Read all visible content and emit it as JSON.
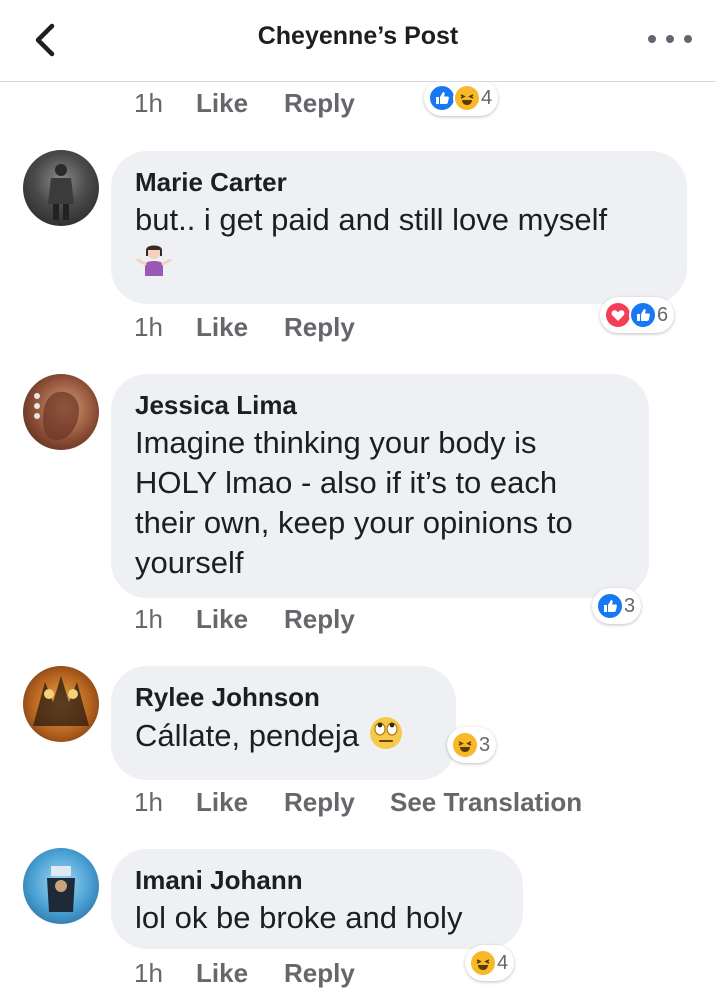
{
  "header": {
    "title": "Cheyenne’s Post"
  },
  "top_row": {
    "time": "1h",
    "like": "Like",
    "reply": "Reply",
    "reaction_count": "4"
  },
  "comments": [
    {
      "author": "Marie Carter",
      "text": "but.. i get paid and still love myself",
      "emoji": "woman-shrugging-emoji",
      "time": "1h",
      "like": "Like",
      "reply": "Reply",
      "reaction_count": "6"
    },
    {
      "author": "Jessica Lima",
      "text": "Imagine thinking your body is HOLY lmao - also if it’s to each their own, keep your opinions to yourself",
      "time": "1h",
      "like": "Like",
      "reply": "Reply",
      "reaction_count": "3"
    },
    {
      "author": "Rylee Johnson",
      "text": "Cállate, pendeja",
      "emoji": "face-with-rolling-eyes-emoji",
      "time": "1h",
      "like": "Like",
      "reply": "Reply",
      "see_translation": "See Translation",
      "reaction_count": "3"
    },
    {
      "author": "Imani Johann",
      "text": "lol ok be broke and holy",
      "time": "1h",
      "like": "Like",
      "reply": "Reply",
      "reaction_count": "4"
    }
  ],
  "colors": {
    "bubble": "#eff0f3",
    "like_blue": "#1877f2",
    "love_red": "#f33e58",
    "haha_yellow": "#f7b928",
    "meta_gray": "#65676b"
  }
}
